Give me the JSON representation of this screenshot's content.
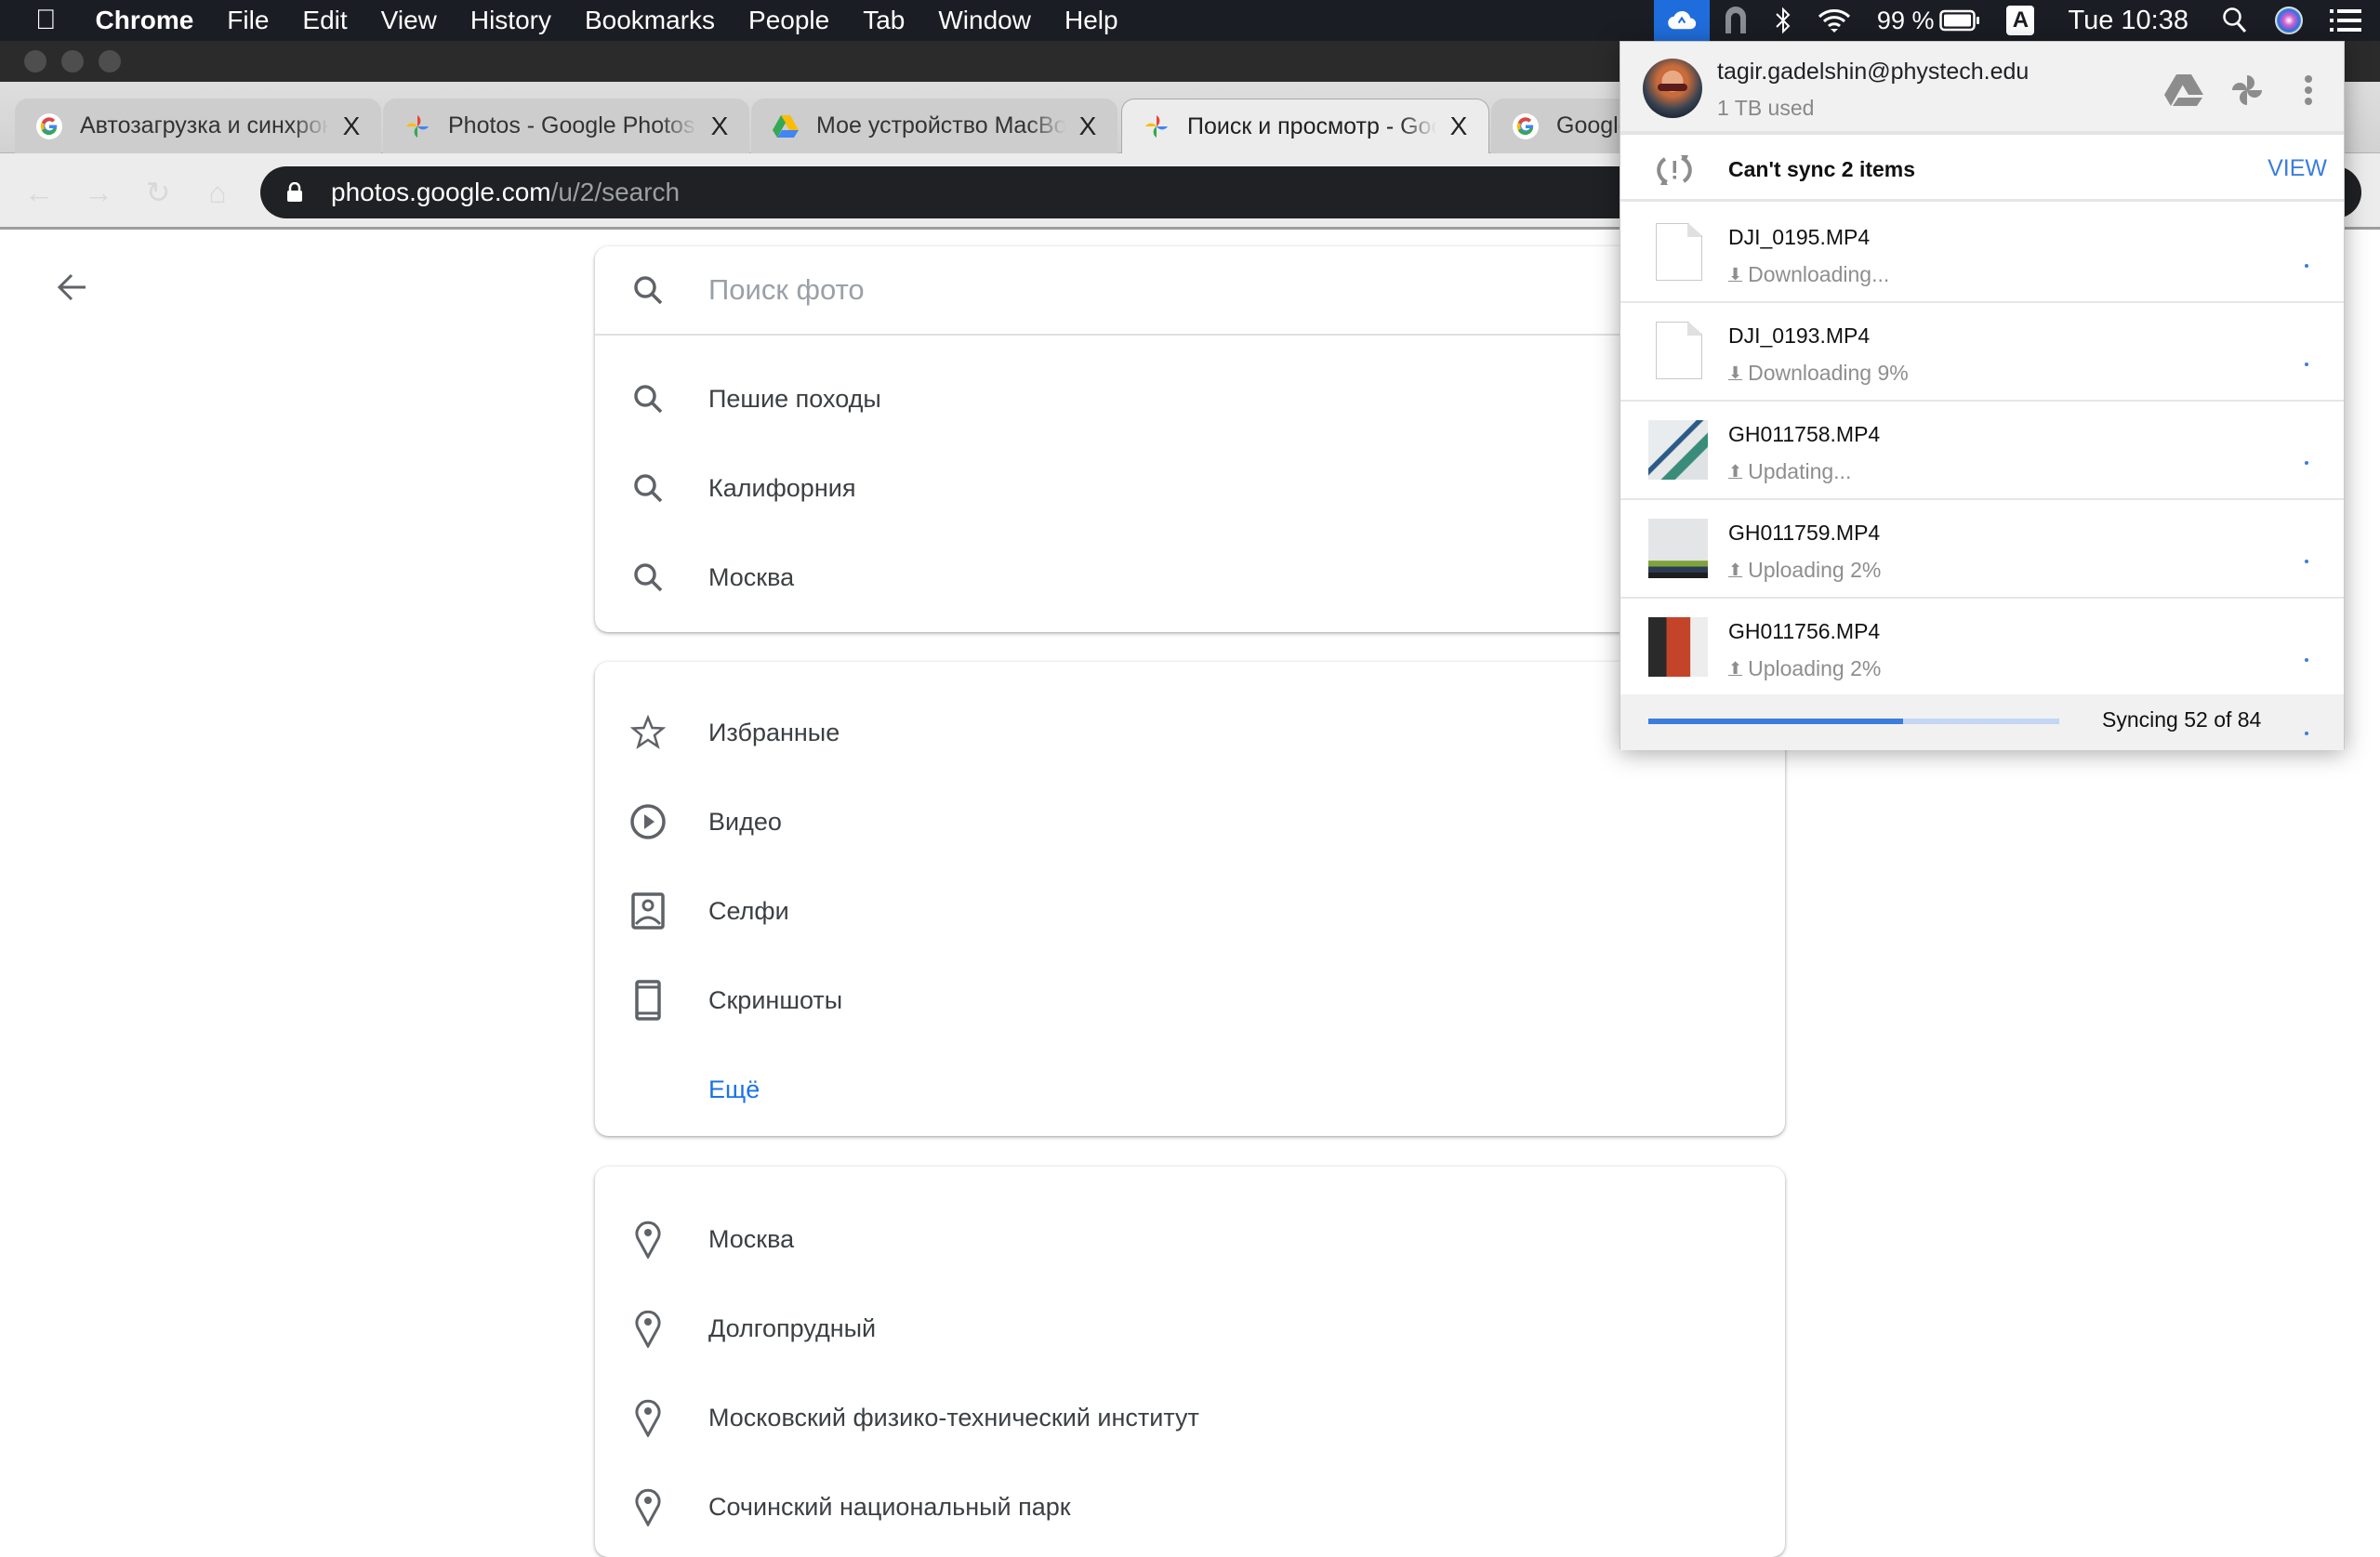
{
  "menubar": {
    "app": "Chrome",
    "items": [
      "File",
      "Edit",
      "View",
      "History",
      "Bookmarks",
      "People",
      "Tab",
      "Window",
      "Help"
    ],
    "status": {
      "battery": "99 %",
      "input_source": "A",
      "clock": "Tue 10:38"
    }
  },
  "browser": {
    "tabs": [
      {
        "title": "Автозагрузка и синхронизация",
        "favicon": "google-g-icon",
        "active": false
      },
      {
        "title": "Photos - Google Photos",
        "favicon": "google-photos-icon",
        "active": false
      },
      {
        "title": "Мое устройство MacBook",
        "favicon": "google-drive-icon",
        "active": false
      },
      {
        "title": "Поиск и просмотр - Google Photos",
        "favicon": "google-photos-icon",
        "active": true
      },
      {
        "title": "Google",
        "favicon": "google-g-icon",
        "active": false
      }
    ],
    "close_glyph": "X",
    "url": {
      "host": "photos.google.com",
      "path": "/u/2/search"
    }
  },
  "photos": {
    "search": {
      "placeholder": "Поиск фото",
      "value": ""
    },
    "suggestions": [
      {
        "label": "Пешие походы",
        "icon": "search-icon"
      },
      {
        "label": "Калифорния",
        "icon": "search-icon"
      },
      {
        "label": "Москва",
        "icon": "search-icon"
      }
    ],
    "categories": [
      {
        "label": "Избранные",
        "icon": "star-icon"
      },
      {
        "label": "Видео",
        "icon": "play-circle-icon"
      },
      {
        "label": "Селфи",
        "icon": "selfie-icon"
      },
      {
        "label": "Скриншоты",
        "icon": "phone-icon"
      }
    ],
    "more_label": "Ещё",
    "places": [
      {
        "label": "Москва",
        "icon": "place-icon"
      },
      {
        "label": "Долгопрудный",
        "icon": "place-icon"
      },
      {
        "label": "Московский физико-технический институт",
        "icon": "place-icon"
      },
      {
        "label": "Сочинский национальный парк",
        "icon": "place-icon"
      }
    ]
  },
  "backup_sync": {
    "account": {
      "email": "tagir.gadelshin@phystech.edu",
      "quota": "1 TB used"
    },
    "error": {
      "text": "Can't sync 2 items",
      "action": "VIEW"
    },
    "files": [
      {
        "name": "DJI_0195.MP4",
        "status": "Downloading...",
        "direction": "download",
        "thumb": "document"
      },
      {
        "name": "DJI_0193.MP4",
        "status": "Downloading 9%",
        "direction": "download",
        "thumb": "document"
      },
      {
        "name": "GH011758.MP4",
        "status": "Updating...",
        "direction": "upload",
        "thumb": "photo-ski"
      },
      {
        "name": "GH011759.MP4",
        "status": "Uploading 2%",
        "direction": "upload",
        "thumb": "photo-snow"
      },
      {
        "name": "GH011756.MP4",
        "status": "Uploading 2%",
        "direction": "upload",
        "thumb": "photo-gear"
      }
    ],
    "progress": {
      "done": 52,
      "total": 84,
      "text": "Syncing 52 of 84"
    },
    "accent": "#3b7ddd"
  }
}
